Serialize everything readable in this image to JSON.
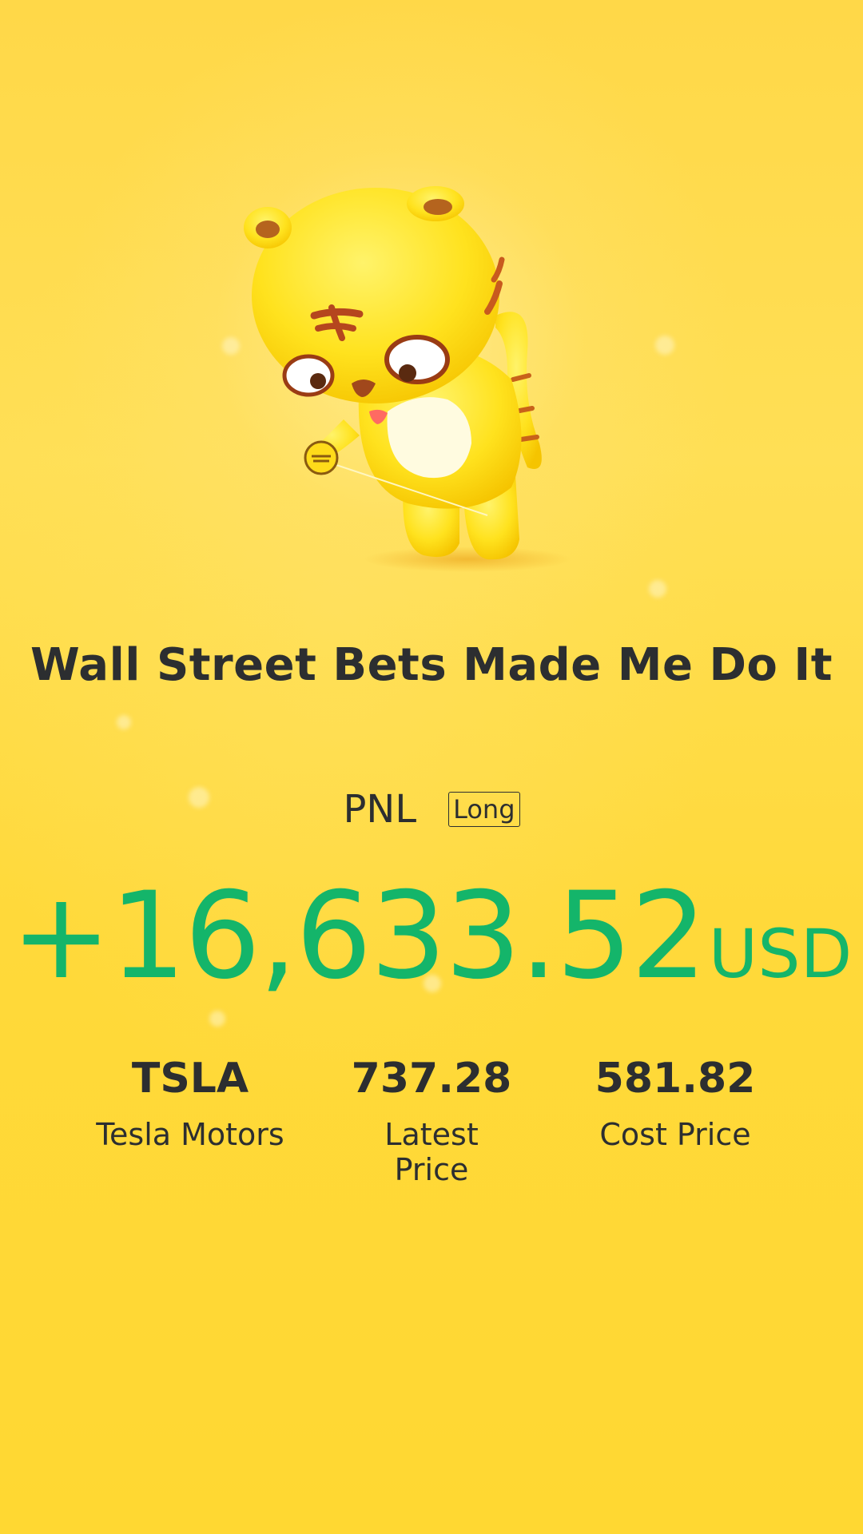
{
  "headline": "Wall Street Bets Made Me Do It",
  "pnl": {
    "label": "PNL",
    "position_type": "Long",
    "amount": "+16,633.52",
    "currency": "USD",
    "amount_color": "#14b56a"
  },
  "stats": [
    {
      "value": "TSLA",
      "label": "Tesla Motors"
    },
    {
      "value": "737.28",
      "label": "Latest Price"
    },
    {
      "value": "581.82",
      "label": "Cost Price"
    }
  ],
  "mascot": {
    "icon": "tiger-mascot-illustration"
  },
  "colors": {
    "background": "#ffd93a",
    "text": "#2c2e30",
    "profit": "#14b56a"
  }
}
